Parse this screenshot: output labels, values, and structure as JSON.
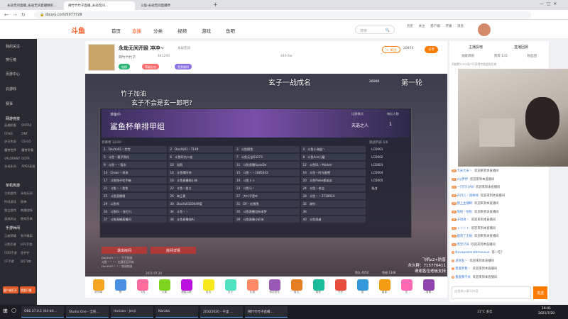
{
  "browser": {
    "tabs": [
      "永劫无间直播_永劫无间直播精彩...",
      "辣竹竹竹子直播_永劫无间...",
      "斗鱼-永劫无间直播界"
    ],
    "url": "douyu.com/5077729"
  },
  "site": {
    "logo": "斗鱼",
    "nav": [
      "首页",
      "直播",
      "分类",
      "视频",
      "游戏",
      "鱼吧"
    ],
    "search_placeholder": "搜索",
    "header_icons": [
      "历史",
      "关注",
      "客户端",
      "开播",
      "消息"
    ]
  },
  "sidebar": {
    "items": [
      "我的关注",
      "排行榜",
      "页游中心",
      "云游戏",
      "赛事"
    ],
    "section1": "网游竞技",
    "section1_games": [
      "英雄联盟",
      "绝地求生",
      "穿越火线",
      "DOTA2",
      "CFHD",
      "DNF",
      "炉石传说",
      "CS:GO",
      "魔兽世界",
      "魔兽争霸",
      "激战2",
      "星际争霸",
      "VALORANT",
      "守望先锋",
      "DOTA",
      "英雄联盟",
      "永劫无间",
      "APEX英雄"
    ],
    "section2": "单机热游",
    "section2_games": [
      "主机游戏",
      "永劫无间",
      "怀旧游戏",
      "原神",
      "独立游戏",
      "刺激战场",
      "战地风云",
      "使命召唤"
    ],
    "section3": "手游休闲",
    "section3_games": [
      "王者荣耀",
      "和平精英",
      "火影忍者",
      "LOL手游",
      "COD手游",
      "金铲铲",
      "CF手游",
      "QQ飞车"
    ],
    "btn_client": "客户端打开",
    "btn_live": "我要开播"
  },
  "room": {
    "title": "永劫无间开殴 冲冲~",
    "streamer": "辣竹竹竹子",
    "category": "永劫无间",
    "followers": "441295",
    "hot": "449.6w",
    "follow_btn": "+ 关注",
    "fans_count": "20974",
    "share_btn": "分享",
    "level_tag": "钻粉",
    "tags": [
      "等级礼包",
      "签到福利"
    ]
  },
  "video": {
    "overlay_left_title": "竹子加油",
    "overlay_question": "玄子不会是玄一郎吧?",
    "overlay_right": "玄子一战成名",
    "overlay_right2": "第一轮",
    "top_counter": "26000",
    "banner_status": "准备中",
    "banner_title": "鲨鱼杯单排甲组",
    "match_mode_label": "比赛模式",
    "match_mode": "天选之人",
    "per_team_label": "每队人数",
    "per_team": "1",
    "players_label": "参赛者 32/60",
    "observers_label": "观战列表 6/6",
    "players": [
      [
        "1",
        "DouYu01丶竹竹"
      ],
      [
        "2",
        "DouYu01丶T149"
      ],
      [
        "3",
        "斗鱼摸鱼"
      ],
      [
        "4",
        "斗鱼小海盗丶"
      ],
      [
        "5",
        "斗鱼丶妻子胖花"
      ],
      [
        "6",
        "斗鱼阿杰二迪"
      ],
      [
        "7",
        "斗鱼元宝63273"
      ],
      [
        "8",
        "斗鱼Ace儿童"
      ],
      [
        "9",
        "斗鱼丶丶饭永"
      ],
      [
        "10",
        "无痕"
      ],
      [
        "11",
        "斗鱼直播SyanDe"
      ],
      [
        "12",
        "斗鱼EL丶Marker"
      ],
      [
        "13",
        "Clown丶采采"
      ],
      [
        "14",
        "斗鱼鹰阿炜"
      ],
      [
        "15",
        "斗鱼丶丶1685442"
      ],
      [
        "16",
        "斗鱼丶时光蛋壁"
      ],
      [
        "17",
        "斗鱼独子吃手嘛"
      ],
      [
        "18",
        "斗鱼直播秘小炜"
      ],
      [
        "19",
        "斗鱼卜卜"
      ],
      [
        "20",
        "斗鱼Pioke都弟弟"
      ],
      [
        "21",
        "斗鱼丶丶鱼鱼"
      ],
      [
        "22",
        "斗鱼丶鱼主"
      ],
      [
        "23",
        "斗鱼马丶"
      ],
      [
        "24",
        "斗鱼丶老白"
      ],
      [
        "25",
        "斗鱼直播哦"
      ],
      [
        "26",
        "海王素"
      ],
      [
        "27",
        "大叶子是叶"
      ],
      [
        "28",
        "斗鱼丶丶3718924"
      ],
      [
        "29",
        "斗鱼鸡"
      ],
      [
        "30",
        "DouYu0320049度"
      ],
      [
        "31",
        "DY丶红猪鱼"
      ],
      [
        "32",
        "海钓"
      ],
      [
        "33",
        "斗鱼EL丶张豆儿"
      ],
      [
        "34",
        "斗鱼丶丶"
      ],
      [
        "35",
        "斗鱼直播没有老梦"
      ],
      [
        "36",
        ""
      ],
      [
        "37",
        "斗鱼直播直播间"
      ],
      [
        "38",
        "斗鱼直播加Ai"
      ],
      [
        "39",
        "斗鱼直播小虾米"
      ],
      [
        "40",
        "斗鱼观者"
      ]
    ],
    "observers": [
      "LCD001",
      "LCD002",
      "LCD003",
      "LCD004",
      "LCD005",
      "观战"
    ],
    "btn_exit": "退出房间",
    "btn_detail": "房间详情",
    "chat_lines": [
      "DouYu01丶丶：竹子加油",
      "斗鱼丶丶丶：比赛还没开始",
      "DouYu01丶丶：加油加油"
    ],
    "date_stamp": "2021.07.20",
    "right_overlay": [
      "飞机x2+防晋",
      "永久群：715776411",
      "谢谢各位老板支持"
    ],
    "bottom_stats": [
      "鱼丸 4052",
      "鱼翅 1348"
    ]
  },
  "gifts": [
    "荧光棒",
    "赞",
    "飞机",
    "火箭",
    "超级火箭",
    "告白",
    "办卡",
    "礼物",
    "粉丝荧光",
    "鱼丸",
    "陪伴",
    "守护",
    "奖",
    "星星",
    "花",
    "宝箱"
  ],
  "right": {
    "tabs": [
      "主播投榜",
      "直播回顾"
    ],
    "rank_tabs": [
      "贡献周榜",
      "贵宾 133",
      "粉丝团"
    ],
    "rank_note": "贡献榜TOP3用户可获得专属虚拟礼物",
    "chat": [
      {
        "lv": "25",
        "user": "大米大米丶",
        "msg": "欢迎来到本直播间"
      },
      {
        "lv": "23",
        "user": "my伊伊",
        "msg": "欢迎来到本直播间"
      },
      {
        "lv": "21",
        "user": "一只叮叮AN",
        "msg": "欢迎来到本直播间"
      },
      {
        "lv": "18",
        "user": "开丹儿丶请帅帅",
        "msg": "欢迎来到本直播间"
      },
      {
        "lv": "16",
        "user": "我上主播啊",
        "msg": "欢迎来到本直播间"
      },
      {
        "lv": "15",
        "user": "啦啦丶啦啦",
        "msg": "欢迎来到本直播间"
      },
      {
        "lv": "14",
        "user": "子进进丶",
        "msg": "欢迎来到本直播间"
      },
      {
        "lv": "12",
        "user": "卜卜卜卜",
        "msg": "欢迎来到本直播间"
      },
      {
        "lv": "11",
        "user": "鹿花了无痕",
        "msg": "欢迎来到本直播间"
      },
      {
        "lv": "10",
        "user": "黑宝158",
        "msg": "欢迎来到本直播间"
      },
      {
        "lv": "9",
        "user": "Novapoolendhmousue",
        "msg": "第一吃?"
      },
      {
        "lv": "8",
        "user": "发财发丶",
        "msg": "欢迎来到本直播间"
      },
      {
        "lv": "7",
        "user": "我爱胖我丶",
        "msg": "欢迎来到本直播间"
      },
      {
        "lv": "6",
        "user": "看鹿我不关",
        "msg": "欢迎来到本直播间"
      }
    ],
    "input_placeholder": "这里输入聊天内容",
    "send_btn": "发送"
  },
  "taskbar": {
    "search": "在这里输入你要搜索的内容",
    "apps": [
      "OBS 27.0.1 (64-bit...",
      "Studio One - 全民...",
      "Horizon - Jenji",
      "Naraka",
      "20322020 - 千里 ...",
      "辣竹竹竹子直播..."
    ],
    "weather": "31°C 多云",
    "time": "16:41",
    "date": "2021/7/20"
  },
  "colors": {
    "accent": "#ff7a00",
    "sidebar": "#2a2b31",
    "brand": "#ff5d23"
  }
}
